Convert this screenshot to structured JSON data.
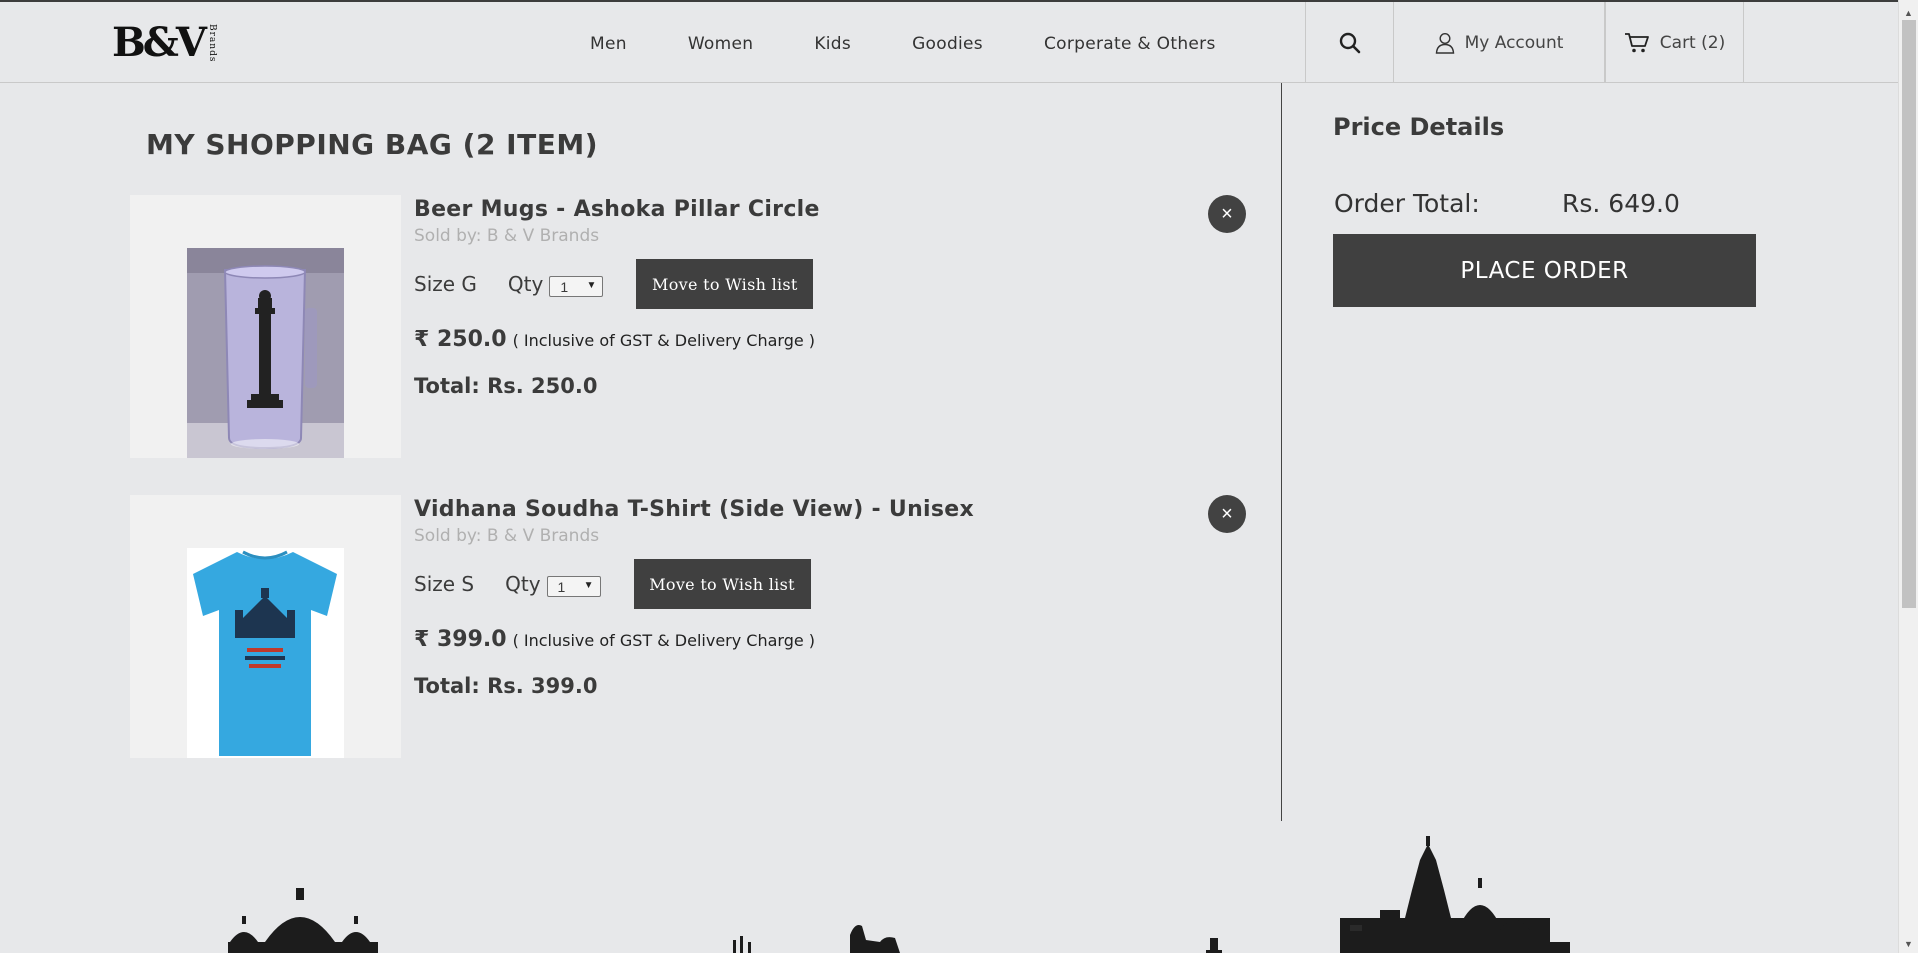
{
  "header": {
    "logo_text": "B&V",
    "logo_sub": "Brands",
    "nav": [
      "Men",
      "Women",
      "Kids",
      "Goodies",
      "Corperate & Others"
    ],
    "account_label": "My Account",
    "cart_label": "Cart (2)"
  },
  "bag": {
    "title": "MY SHOPPING BAG (2 ITEM)",
    "remove_symbol": "×",
    "items": [
      {
        "name": "Beer Mugs - Ashoka Pillar Circle",
        "seller": "Sold by: B & V Brands",
        "size": "Size G",
        "qty_label": "Qty",
        "qty_value": "1",
        "wish_label": "Move to Wish list",
        "price": "₹ 250.0",
        "price_note": "( Inclusive of GST & Delivery Charge )",
        "total": "Total: Rs. 250.0"
      },
      {
        "name": "Vidhana Soudha T-Shirt (Side View) - Unisex",
        "seller": "Sold by: B & V Brands",
        "size": "Size S",
        "qty_label": "Qty",
        "qty_value": "1",
        "wish_label": "Move to Wish list",
        "price": "₹ 399.0",
        "price_note": "( Inclusive of GST & Delivery Charge )",
        "total": "Total: Rs. 399.0"
      }
    ]
  },
  "summary": {
    "title": "Price Details",
    "order_total_label": "Order Total:",
    "order_total_value": "Rs. 649.0",
    "place_order_label": "PLACE ORDER"
  },
  "colors": {
    "background": "#e7e8ea",
    "button_dark": "#404040",
    "tshirt_blue": "#35a8e0"
  }
}
